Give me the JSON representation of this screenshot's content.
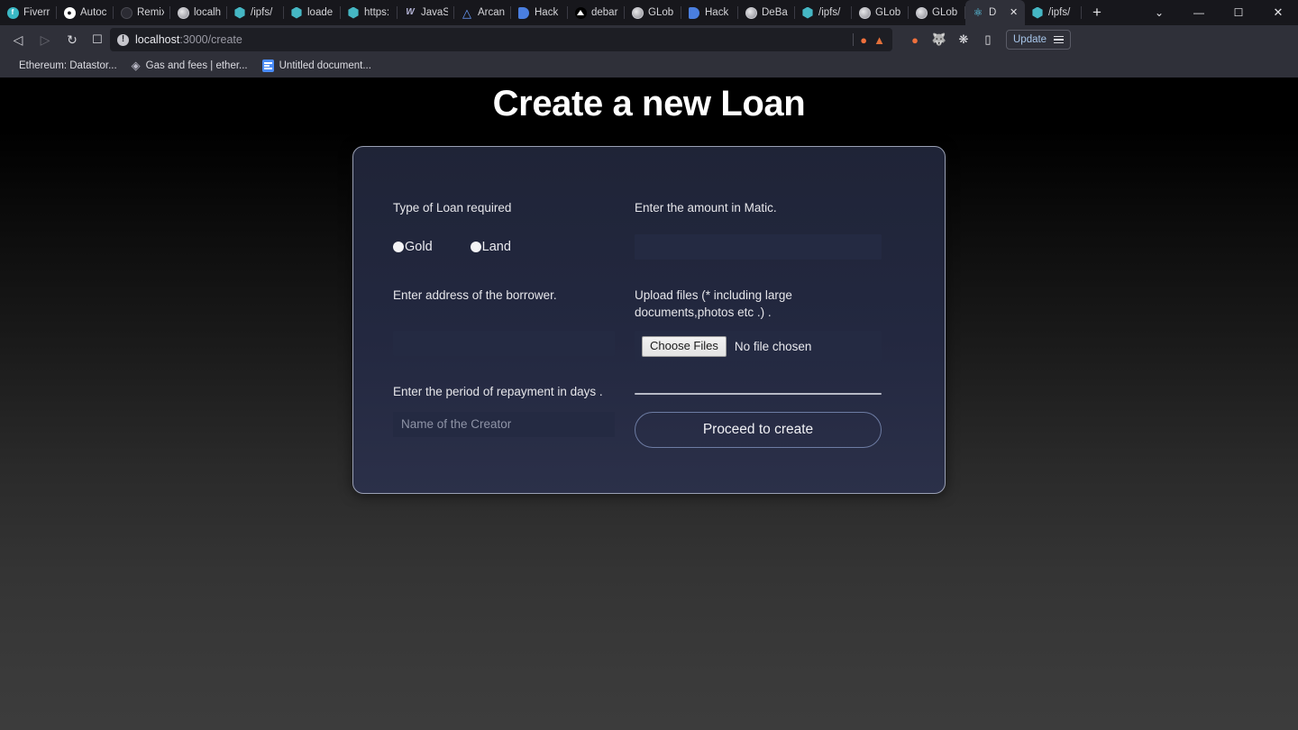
{
  "browser": {
    "tabs": [
      {
        "label": "Fiverr",
        "icon": "fiverr-icon",
        "active": false
      },
      {
        "label": "Autoc",
        "icon": "github-icon",
        "active": false
      },
      {
        "label": "Remix",
        "icon": "remix-icon",
        "active": false
      },
      {
        "label": "localh",
        "icon": "globe-icon",
        "active": false
      },
      {
        "label": "/ipfs/",
        "icon": "ipfs-icon",
        "active": false
      },
      {
        "label": "loade",
        "icon": "ipfs-icon",
        "active": false
      },
      {
        "label": "https:",
        "icon": "ipfs-icon",
        "active": false
      },
      {
        "label": "JavaS",
        "icon": "w3schools-icon",
        "active": false
      },
      {
        "label": "Arcan",
        "icon": "arcana-icon",
        "active": false
      },
      {
        "label": "Hack",
        "icon": "hackerearth-icon",
        "active": false
      },
      {
        "label": "debar",
        "icon": "vercel-icon",
        "active": false
      },
      {
        "label": "GLob",
        "icon": "globe-icon",
        "active": false
      },
      {
        "label": "Hack",
        "icon": "hackerearth-icon",
        "active": false
      },
      {
        "label": "DeBa",
        "icon": "globe-icon",
        "active": false
      },
      {
        "label": "/ipfs/",
        "icon": "ipfs-icon",
        "active": false
      },
      {
        "label": "GLob",
        "icon": "globe-icon",
        "active": false
      },
      {
        "label": "GLob",
        "icon": "globe-icon",
        "active": false
      },
      {
        "label": "D",
        "icon": "react-icon",
        "active": true
      },
      {
        "label": "/ipfs/",
        "icon": "ipfs-icon",
        "active": false
      }
    ],
    "new_tab_label": "+",
    "tab_list_chevron": "⌄",
    "window_minimize": "—",
    "window_maximize": "☐",
    "window_close": "✕",
    "nav": {
      "back": "◁",
      "forward": "▷",
      "reload": "↻",
      "bookmark": "☐"
    },
    "omnibox": {
      "url_host": "localhost",
      "url_rest": ":3000/create",
      "info_icon": "!",
      "brave_lion": "🦁",
      "brave_shield": "▲"
    },
    "extensions": [
      {
        "name": "brave-rewards-icon",
        "glyph": "●"
      },
      {
        "name": "metamask-icon",
        "glyph": "🦊"
      },
      {
        "name": "extensions-puzzle-icon",
        "glyph": "✦"
      },
      {
        "name": "wallet-icon",
        "glyph": "▤"
      }
    ],
    "update_label": "Update",
    "bookmarks": [
      {
        "label": "Ethereum: Datastor...",
        "icon": "globe-icon"
      },
      {
        "label": "Gas and fees | ether...",
        "icon": "ethereum-icon"
      },
      {
        "label": "Untitled document...",
        "icon": "google-docs-icon"
      }
    ]
  },
  "page": {
    "title": "Create a new Loan",
    "form": {
      "loan_type_label": "Type of Loan required",
      "loan_type_options": [
        {
          "value": "gold",
          "label": "Gold"
        },
        {
          "value": "land",
          "label": "Land"
        }
      ],
      "amount_label": "Enter the amount in Matic.",
      "amount_value": "",
      "amount_placeholder": "",
      "borrower_label": "Enter address of the borrower.",
      "borrower_value": "",
      "borrower_placeholder": "",
      "period_label": "Enter the period of repayment in days .",
      "period_value": "",
      "period_placeholder": "Name of the Creator",
      "upload_label": "Upload files (* including large documents,photos etc .) .",
      "choose_files_label": "Choose Files",
      "no_file_label": "No file chosen",
      "submit_label": "Proceed to create"
    }
  },
  "colors": {
    "card_bg": "#232840",
    "card_border": "#9aa0b4",
    "field_bg": "#242a42",
    "text_primary": "#e6e6ea",
    "accent_border": "#6d7ca3"
  }
}
